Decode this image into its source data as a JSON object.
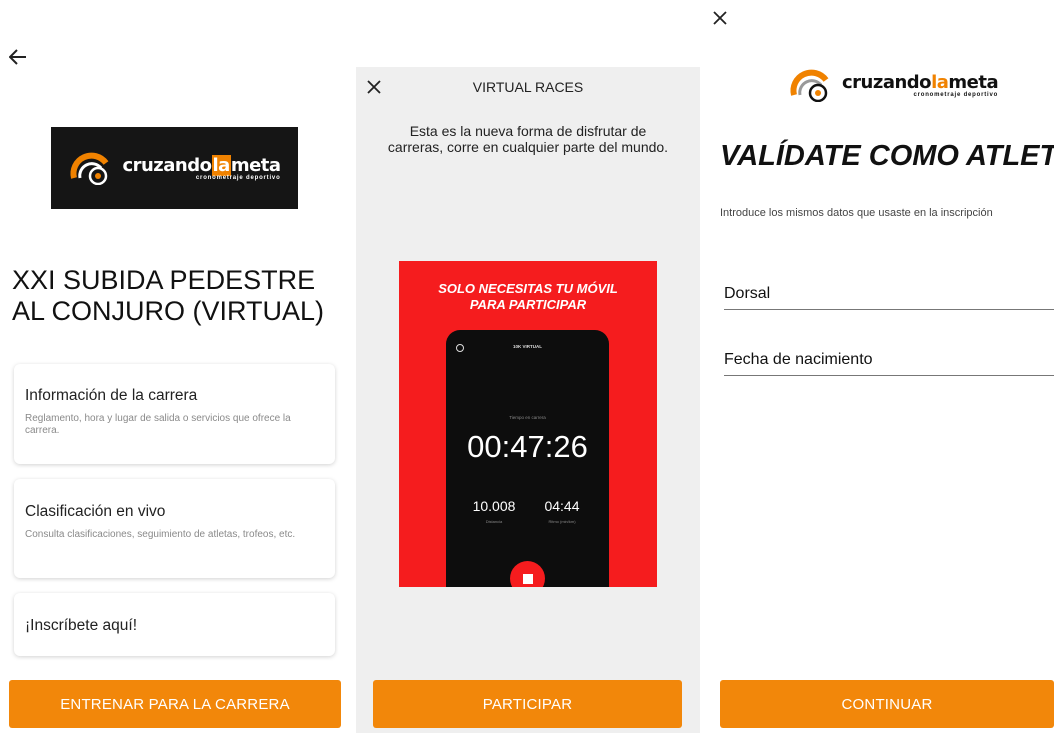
{
  "panel1": {
    "back_icon": "arrow-left-icon",
    "logo": {
      "word_a": "cruzando",
      "word_b": "la",
      "word_c": "meta",
      "tagline": "cronometraje deportivo"
    },
    "race_title": "XXI SUBIDA PEDESTRE AL CONJURO (VIRTUAL)",
    "cards": [
      {
        "title": "Información de la carrera",
        "desc": "Reglamento, hora y lugar de salida o servicios que ofrece la carrera."
      },
      {
        "title": "Clasificación en vivo",
        "desc": "Consulta clasificaciones, seguimiento de atletas, trofeos, etc."
      },
      {
        "title": "¡Inscríbete aquí!"
      }
    ],
    "cta": "ENTRENAR PARA LA CARRERA"
  },
  "panel2": {
    "close_icon": "close-icon",
    "title": "VIRTUAL RACES",
    "intro": "Esta es la nueva forma de disfrutar de carreras, corre en cualquier parte del mundo.",
    "promo": {
      "headline_1": "SOLO NECESITAS TU MÓVIL",
      "headline_2": "PARA PARTICIPAR",
      "phone_label": "10K VIRTUAL",
      "time_label": "Tiempo en carrera",
      "time": "00:47:26",
      "distance": "10.008",
      "distance_label": "Distancia",
      "pace": "04:44",
      "pace_label": "Ritmo (min/km)"
    },
    "cta": "PARTICIPAR"
  },
  "panel3": {
    "close_icon": "close-icon",
    "logo": {
      "word_a": "cruzando",
      "word_b": "la",
      "word_c": "meta",
      "tagline": "cronometraje deportivo"
    },
    "title": "VALÍDATE COMO ATLETA",
    "intro": "Introduce los mismos datos que usaste en la inscripción",
    "fields": {
      "dorsal": "Dorsal",
      "birthdate": "Fecha de nacimiento"
    },
    "cta": "CONTINUAR"
  },
  "colors": {
    "accent": "#f2870a",
    "promo_red": "#f51c1e",
    "logo_bg": "#151515"
  }
}
